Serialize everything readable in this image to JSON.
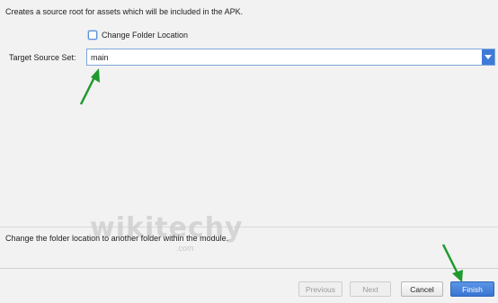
{
  "description": "Creates a source root for assets which will be included in the APK.",
  "change_folder": {
    "label": "Change Folder Location",
    "checked": false
  },
  "target_source_set": {
    "label": "Target Source Set:",
    "value": "main"
  },
  "help_text": "Change the folder location to another folder within the module.",
  "watermark": {
    "text": "wikitechy",
    "sub": ".com"
  },
  "buttons": {
    "previous": "Previous",
    "next": "Next",
    "cancel": "Cancel",
    "finish": "Finish"
  },
  "colors": {
    "accent": "#3e7bd8",
    "annotation_arrow": "#1f9a2e"
  },
  "icons": {
    "dropdown": "chevron-down-icon",
    "annotation": "arrow-annotation-icon"
  }
}
